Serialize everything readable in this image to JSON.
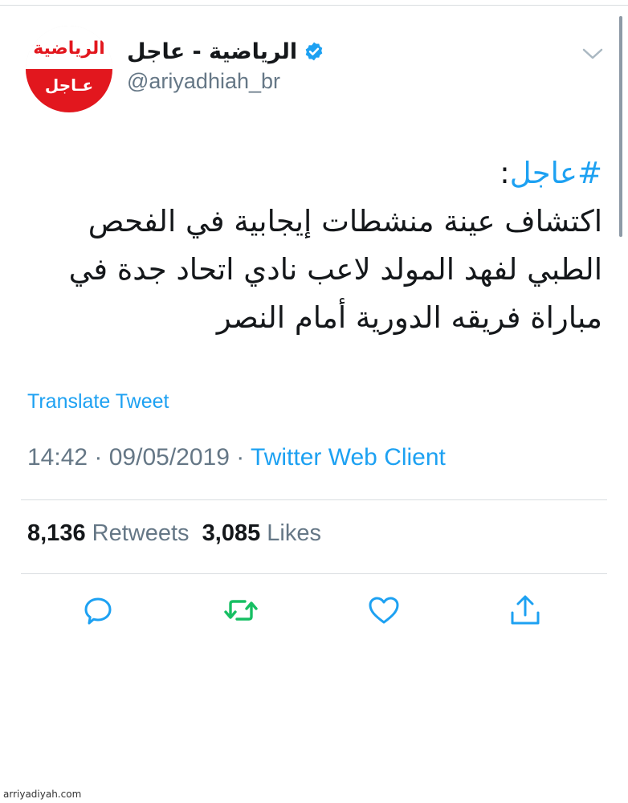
{
  "profile": {
    "avatar_logo_text": "الرياضية",
    "avatar_badge_text": "عـاجل",
    "display_name": "الرياضية - عاجل",
    "verified": true,
    "handle": "@ariyadhiah_br"
  },
  "tweet": {
    "hashtag": "#عاجل",
    "hashtag_suffix": ":",
    "lines": [
      "اكتشاف عينة منشطات إيجابية في الفحص",
      "الطبي لفهد المولد لاعب نادي اتحاد جدة في",
      "مباراة فريقه الدورية أمام النصر"
    ],
    "translate_label": "Translate Tweet",
    "time": "14:42",
    "date": "09/05/2019",
    "separator": " · ",
    "client": "Twitter Web Client"
  },
  "stats": {
    "retweets_count": "8,136",
    "retweets_label": "Retweets",
    "likes_count": "3,085",
    "likes_label": "Likes"
  },
  "actions": {
    "reply_icon": "reply-icon",
    "retweet_icon": "retweet-icon",
    "like_icon": "heart-icon",
    "share_icon": "share-icon"
  },
  "colors": {
    "accent": "#1da1f2",
    "retweeted": "#17bf63",
    "text": "#14171a",
    "secondary": "#657786",
    "brand_red": "#e2171e"
  },
  "watermark": "arriyadiyah.com"
}
